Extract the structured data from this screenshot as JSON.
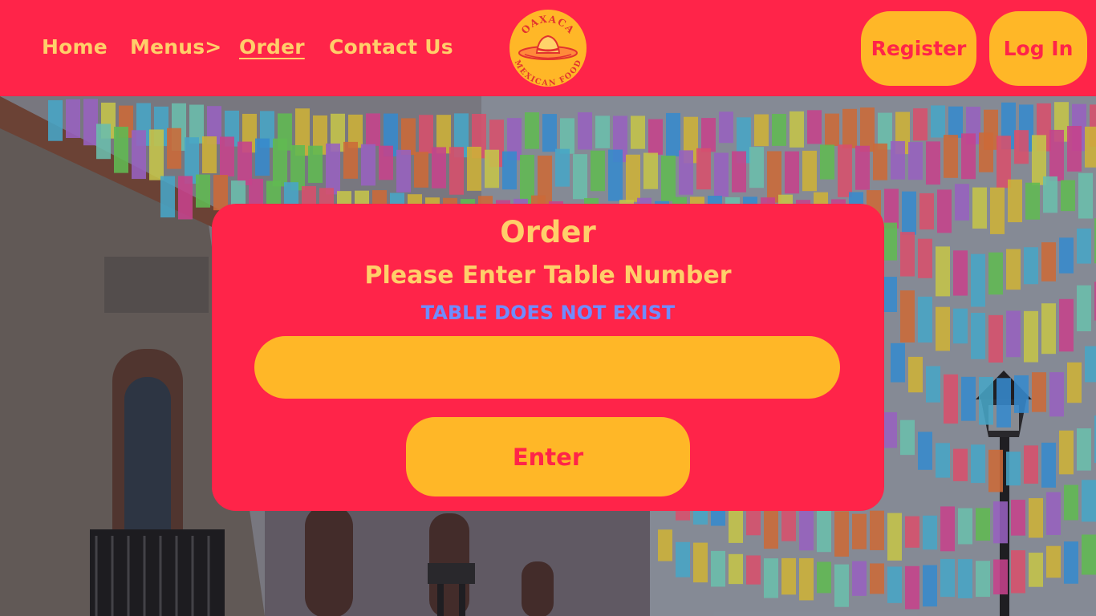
{
  "nav": {
    "home": "Home",
    "menus": "Menus>",
    "order": "Order",
    "contact": "Contact Us"
  },
  "logo": {
    "top_text": "OAXACA",
    "bottom_text": "MEXICAN FOOD"
  },
  "header_buttons": {
    "register": "Register",
    "login": "Log In"
  },
  "order_card": {
    "title": "Order",
    "subtitle": "Please Enter Table Number",
    "error": "TABLE DOES NOT EXIST",
    "input_value": "",
    "input_placeholder": "",
    "enter_label": "Enter"
  },
  "colors": {
    "brand_red": "#ff2449",
    "brand_yellow": "#ffb727",
    "text_cream": "#ffcf6a",
    "error_blue": "#6f8cff"
  }
}
